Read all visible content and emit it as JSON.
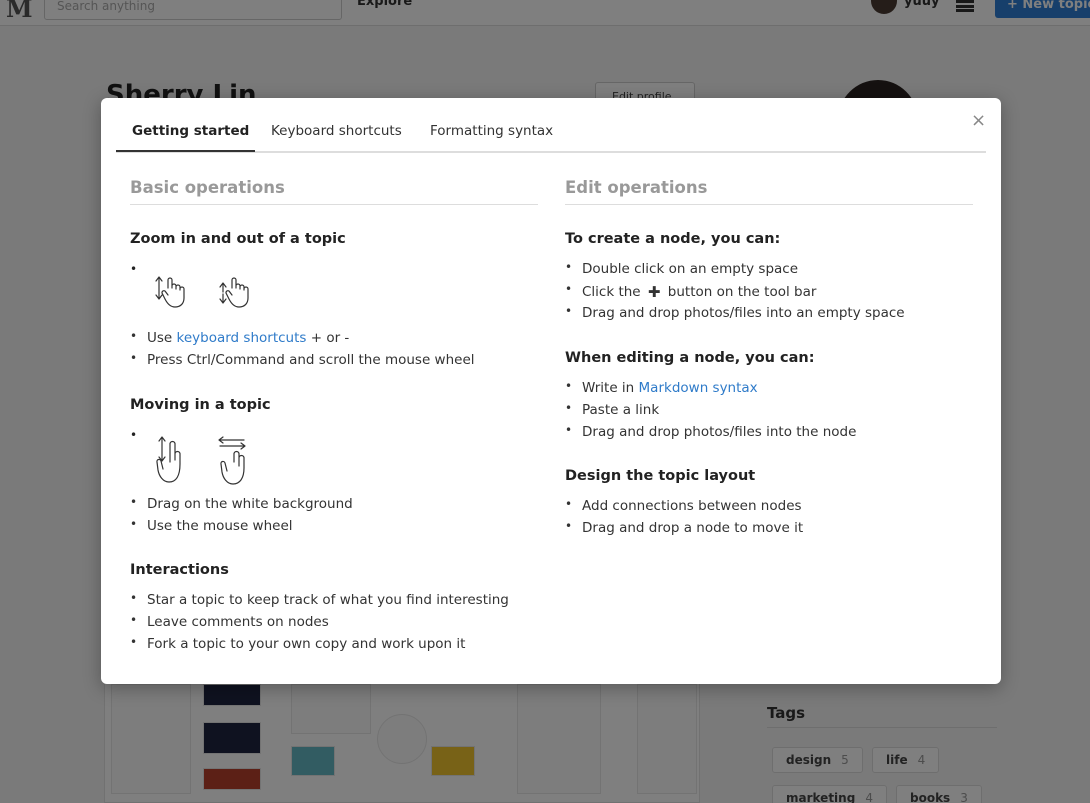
{
  "header": {
    "search_placeholder": "Search anything",
    "explore": "Explore",
    "username": "yuuy",
    "new_topic": "+ New topic"
  },
  "profile": {
    "name": "Sherry Lin",
    "edit_profile": "Edit profile"
  },
  "tags": {
    "title": "Tags",
    "items": [
      {
        "label": "design",
        "count": "5"
      },
      {
        "label": "life",
        "count": "4"
      },
      {
        "label": "marketing",
        "count": "4"
      },
      {
        "label": "books",
        "count": "3"
      }
    ]
  },
  "modal": {
    "close": "×",
    "tabs": [
      "Getting started",
      "Keyboard shortcuts",
      "Formatting syntax"
    ],
    "left": {
      "title": "Basic operations",
      "zoom": {
        "heading": "Zoom in and out of a topic",
        "items": [
          {
            "pre": "Use ",
            "link": "keyboard shortcuts",
            "post": " + or -"
          },
          {
            "text": "Press Ctrl/Command and scroll the mouse wheel"
          }
        ]
      },
      "moving": {
        "heading": "Moving in a topic",
        "items": [
          "Drag on the white background",
          "Use the mouse wheel"
        ]
      },
      "interactions": {
        "heading": "Interactions",
        "items": [
          "Star a topic to keep track of what you find interesting",
          "Leave comments on nodes",
          "Fork a topic to your own copy and work upon it"
        ]
      }
    },
    "right": {
      "title": "Edit operations",
      "create": {
        "heading": "To create a node, you can:",
        "items": [
          {
            "text": "Double click on an empty space"
          },
          {
            "pre": "Click the ",
            "icon": "plus-icon",
            "post": " button on the tool bar"
          },
          {
            "text": "Drag and drop photos/files into an empty space"
          }
        ]
      },
      "editing": {
        "heading": "When editing a node, you can:",
        "items": [
          {
            "pre": "Write in ",
            "link": "Markdown syntax"
          },
          {
            "text": "Paste a link"
          },
          {
            "text": "Drag and drop photos/files into the node"
          }
        ]
      },
      "layout": {
        "heading": "Design the topic layout",
        "items": [
          "Add connections between nodes",
          "Drag and drop a node to move it"
        ]
      }
    }
  },
  "colors": {
    "link": "#2f7bc9",
    "primary_button": "#2f7fd6",
    "overlay": "rgba(0,0,0,0.5)"
  }
}
